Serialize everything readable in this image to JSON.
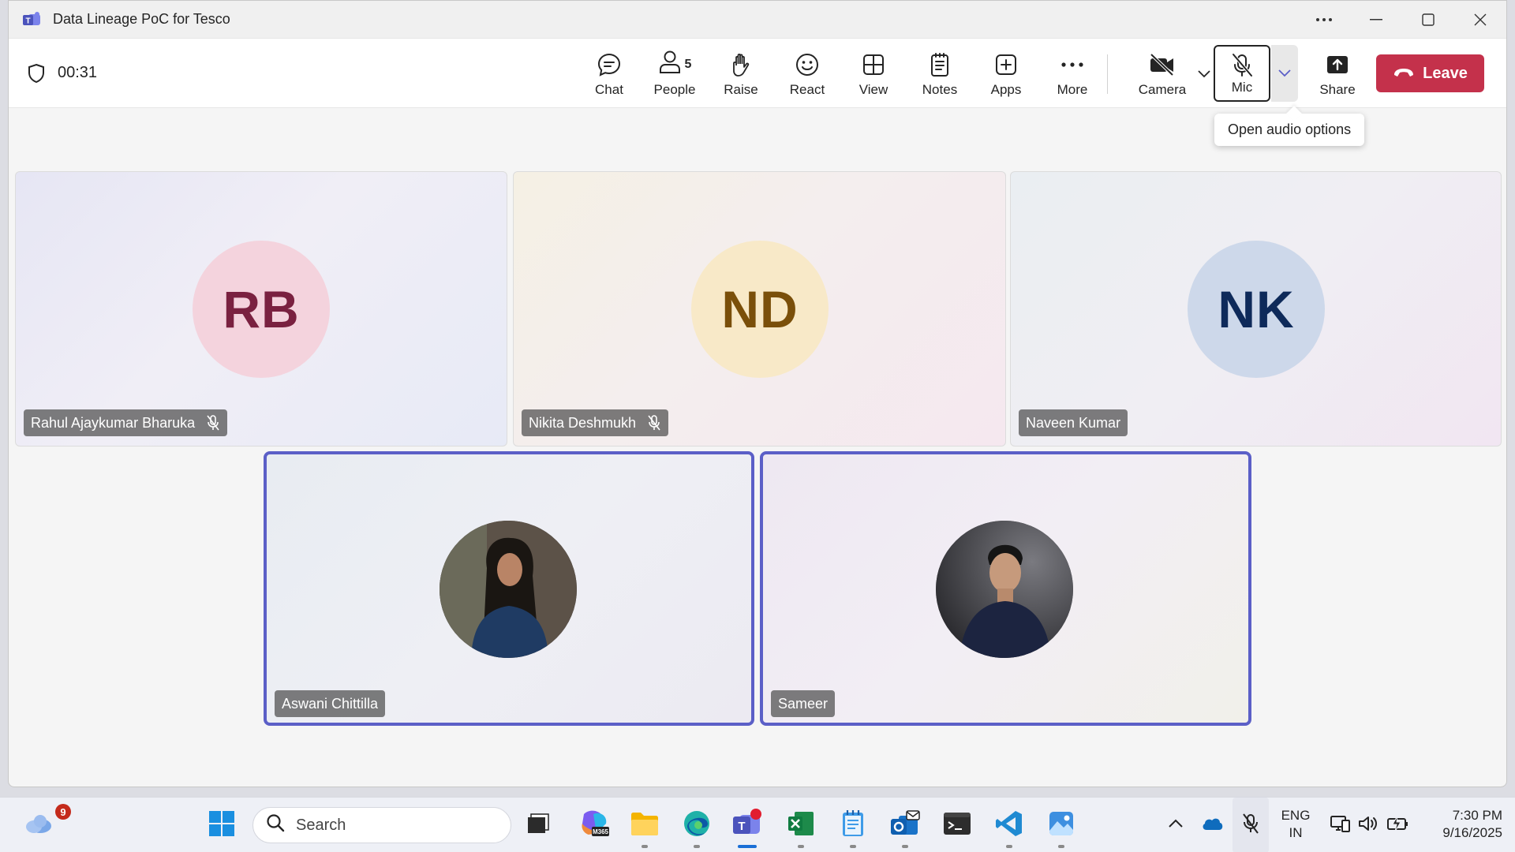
{
  "window": {
    "title": "Data Lineage PoC for Tesco"
  },
  "toolbar": {
    "timer": "00:31",
    "buttons": {
      "chat": "Chat",
      "people": "People",
      "people_count": "5",
      "raise": "Raise",
      "react": "React",
      "view": "View",
      "notes": "Notes",
      "apps": "Apps",
      "more": "More",
      "camera": "Camera",
      "mic": "Mic",
      "share": "Share",
      "leave": "Leave"
    },
    "tooltip": "Open audio options"
  },
  "participants": [
    {
      "name": "Rahul Ajaykumar Bharuka",
      "initials": "RB",
      "muted": true,
      "avatar_bg": "#f4d3dd",
      "initials_color": "#7a2140"
    },
    {
      "name": "Nikita Deshmukh",
      "initials": "ND",
      "muted": true,
      "avatar_bg": "#f8e9c8",
      "initials_color": "#7a4f0a"
    },
    {
      "name": "Naveen Kumar",
      "initials": "NK",
      "muted": false,
      "avatar_bg": "#cdd8ea",
      "initials_color": "#0e2a5a"
    },
    {
      "name": "Aswani Chittilla",
      "photo": true,
      "speaking": true
    },
    {
      "name": "Sameer",
      "photo": true,
      "speaking": true
    }
  ],
  "taskbar": {
    "weather_badge": "9",
    "search_placeholder": "Search",
    "language": "ENG",
    "region": "IN",
    "time": "7:30 PM",
    "date": "9/16/2025",
    "pinned_apps": [
      "task-view",
      "microsoft-365",
      "file-explorer",
      "edge",
      "teams",
      "excel",
      "notepad",
      "outlook",
      "terminal",
      "vscode",
      "photos"
    ]
  },
  "colors": {
    "accent": "#5b5fc7",
    "leave": "#c4314b",
    "teams_purple": "#4b53bc"
  }
}
